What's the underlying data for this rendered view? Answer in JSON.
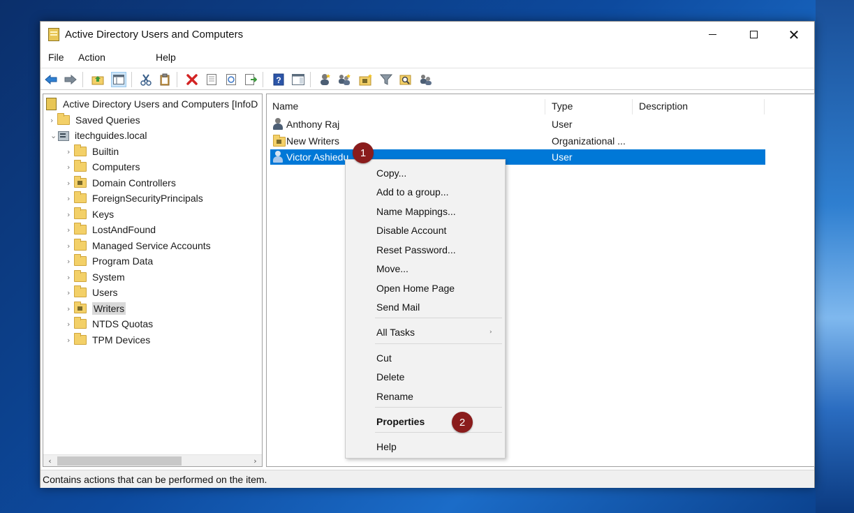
{
  "window": {
    "title": "Active Directory Users and Computers",
    "controls": [
      "minimize",
      "maximize",
      "close"
    ]
  },
  "menubar": [
    "File",
    "Action",
    "Help"
  ],
  "toolbar": {
    "icons": [
      "back-arrow-icon",
      "forward-arrow-icon",
      "up-folder-icon",
      "show-console-tree-icon",
      "cut-icon",
      "paste-icon",
      "delete-icon",
      "properties-icon",
      "refresh-icon",
      "export-list-icon",
      "help-icon",
      "action-pane-icon",
      "new-user-icon",
      "new-group-icon",
      "new-ou-icon",
      "filter-icon",
      "find-icon",
      "add-to-group-icon"
    ]
  },
  "tree": {
    "root": "Active Directory Users and Computers [InfoD",
    "items": [
      {
        "label": "Saved Queries"
      },
      {
        "label": "itechguides.local"
      },
      {
        "label": "Builtin"
      },
      {
        "label": "Computers"
      },
      {
        "label": "Domain Controllers"
      },
      {
        "label": "ForeignSecurityPrincipals"
      },
      {
        "label": "Keys"
      },
      {
        "label": "LostAndFound"
      },
      {
        "label": "Managed Service Accounts"
      },
      {
        "label": "Program Data"
      },
      {
        "label": "System"
      },
      {
        "label": "Users"
      },
      {
        "label": "Writers"
      },
      {
        "label": "NTDS Quotas"
      },
      {
        "label": "TPM Devices"
      }
    ],
    "selected": "Writers"
  },
  "list": {
    "columns": [
      "Name",
      "Type",
      "Description"
    ],
    "rows": [
      {
        "name": "Anthony Raj",
        "type": "User",
        "description": ""
      },
      {
        "name": "New Writers",
        "type": "Organizational ...",
        "description": ""
      },
      {
        "name": "Victor Ashiedu",
        "type": "User",
        "description": ""
      }
    ],
    "selected_row": "Victor Ashiedu"
  },
  "context_menu": {
    "items": [
      "Copy...",
      "Add to a group...",
      "Name Mappings...",
      "Disable Account",
      "Reset Password...",
      "Move...",
      "Open Home Page",
      "Send Mail",
      "All Tasks",
      "Cut",
      "Delete",
      "Rename",
      "Properties",
      "Help"
    ],
    "bold_item": "Properties"
  },
  "badges": [
    "1",
    "2"
  ],
  "status": "Contains actions that can be performed on the item.",
  "colors": {
    "selection": "#0078d7",
    "badge": "#8a1c1c",
    "folder": "#f3d068"
  }
}
